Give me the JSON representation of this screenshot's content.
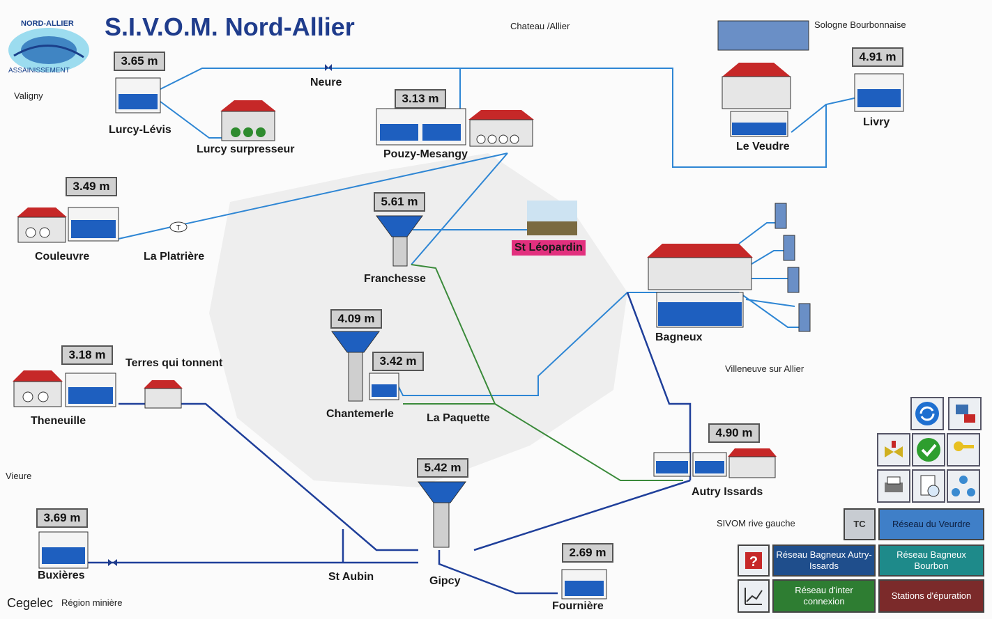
{
  "header": {
    "title": "S.I.V.O.M. Nord-Allier",
    "logo_text_top": "NORD-ALLIER",
    "logo_text_bottom": "ASSAINISSEMENT"
  },
  "region_labels": {
    "chateau": "Chateau /Allier",
    "sologne": "Sologne Bourbonnaise",
    "valigny": "Valigny",
    "villeneuve": "Villeneuve sur Allier",
    "vieure": "Vieure",
    "sivom_rive": "SIVOM rive gauche",
    "cegelec": "Cegelec",
    "region_miniere": "Région minière"
  },
  "sites": {
    "lurcy_levis": {
      "name": "Lurcy-Lévis",
      "level": "3.65 m"
    },
    "lurcy_surpresseur": {
      "name": "Lurcy surpresseur"
    },
    "neure": {
      "name": "Neure"
    },
    "pouzy": {
      "name": "Pouzy-Mesangy",
      "level": "3.13 m"
    },
    "le_veudre": {
      "name": "Le Veudre"
    },
    "livry": {
      "name": "Livry",
      "level": "4.91 m"
    },
    "couleuvre": {
      "name": "Couleuvre",
      "level": "3.49 m"
    },
    "la_platriere": {
      "name": "La Platrière"
    },
    "franchesse": {
      "name": "Franchesse",
      "level": "5.61 m"
    },
    "st_leopardin": {
      "name": "St Léopardin"
    },
    "bagneux": {
      "name": "Bagneux"
    },
    "theneuille": {
      "name": "Theneuille",
      "level": "3.18 m"
    },
    "terres": {
      "name": "Terres qui tonnent"
    },
    "chantemerle": {
      "name": "Chantemerle",
      "level": "4.09 m",
      "level2": "3.42 m"
    },
    "la_paquette": {
      "name": "La Paquette"
    },
    "autry": {
      "name": "Autry Issards",
      "level": "4.90 m"
    },
    "gipcy": {
      "name": "Gipcy",
      "level": "5.42 m"
    },
    "st_aubin": {
      "name": "St Aubin"
    },
    "buxieres": {
      "name": "Buxières",
      "level": "3.69 m"
    },
    "fourniere": {
      "name": "Fournière",
      "level": "2.69 m"
    }
  },
  "nav_buttons": {
    "tc": "TC",
    "reseau_veudre": "Réseau du Veurdre",
    "reseau_autry": "Réseau Bagneux Autry-Issards",
    "reseau_bourbon": "Réseau Bagneux Bourbon",
    "reseau_interconnexion": "Réseau d'inter connexion",
    "stations": "Stations d'épuration"
  },
  "colors": {
    "title": "#1f3c8c",
    "pipe_blue": "#2e86d4",
    "pipe_dark": "#1f3f9a",
    "pipe_green": "#3a8a3a",
    "roof": "#c62828",
    "water": "#1e5fbf",
    "btn_blue": "#1f4e8c",
    "btn_light": "#3f7fc8",
    "btn_teal": "#1e8a8a",
    "btn_green": "#2e7d32",
    "btn_maroon": "#7b2a2a"
  }
}
